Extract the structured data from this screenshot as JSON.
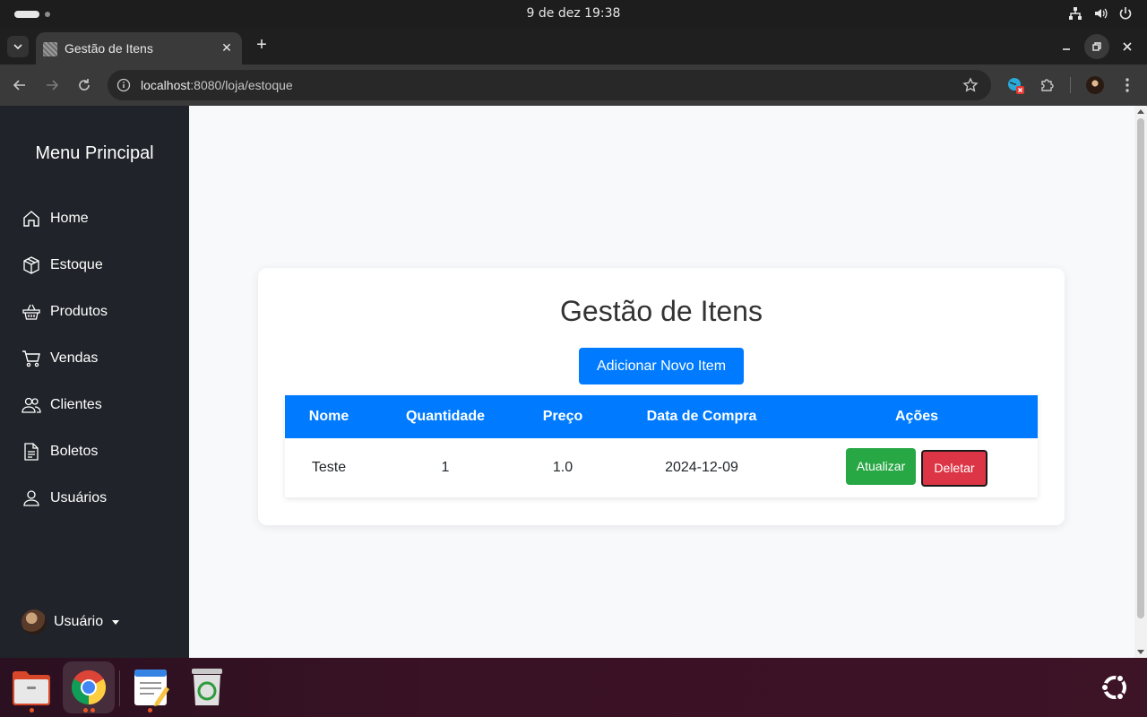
{
  "system": {
    "clock": "9 de dez  19:38",
    "tray_icons": [
      "network-icon",
      "volume-icon",
      "power-icon"
    ]
  },
  "browser": {
    "tab_title": "Gestão de Itens",
    "url_host": "localhost",
    "url_rest": ":8080/loja/estoque"
  },
  "sidebar": {
    "title": "Menu Principal",
    "items": [
      {
        "label": "Home",
        "icon": "home-icon"
      },
      {
        "label": "Estoque",
        "icon": "box-icon"
      },
      {
        "label": "Produtos",
        "icon": "basket-icon"
      },
      {
        "label": "Vendas",
        "icon": "cart-icon"
      },
      {
        "label": "Clientes",
        "icon": "people-icon"
      },
      {
        "label": "Boletos",
        "icon": "document-icon"
      },
      {
        "label": "Usuários",
        "icon": "person-icon"
      }
    ],
    "user_label": "Usuário"
  },
  "main": {
    "title": "Gestão de Itens",
    "add_button": "Adicionar Novo Item",
    "table": {
      "headers": [
        "Nome",
        "Quantidade",
        "Preço",
        "Data de Compra",
        "Ações"
      ],
      "rows": [
        {
          "nome": "Teste",
          "quantidade": "1",
          "preco": "1.0",
          "data": "2024-12-09",
          "update_label": "Atualizar",
          "delete_label": "Deletar"
        }
      ]
    }
  },
  "colors": {
    "primary": "#007bff",
    "success": "#28a745",
    "danger": "#dc3545",
    "sidebar_bg": "#202329"
  },
  "dock": [
    "files-icon",
    "chrome-icon",
    "text-editor-icon",
    "trash-icon",
    "ubuntu-icon"
  ]
}
